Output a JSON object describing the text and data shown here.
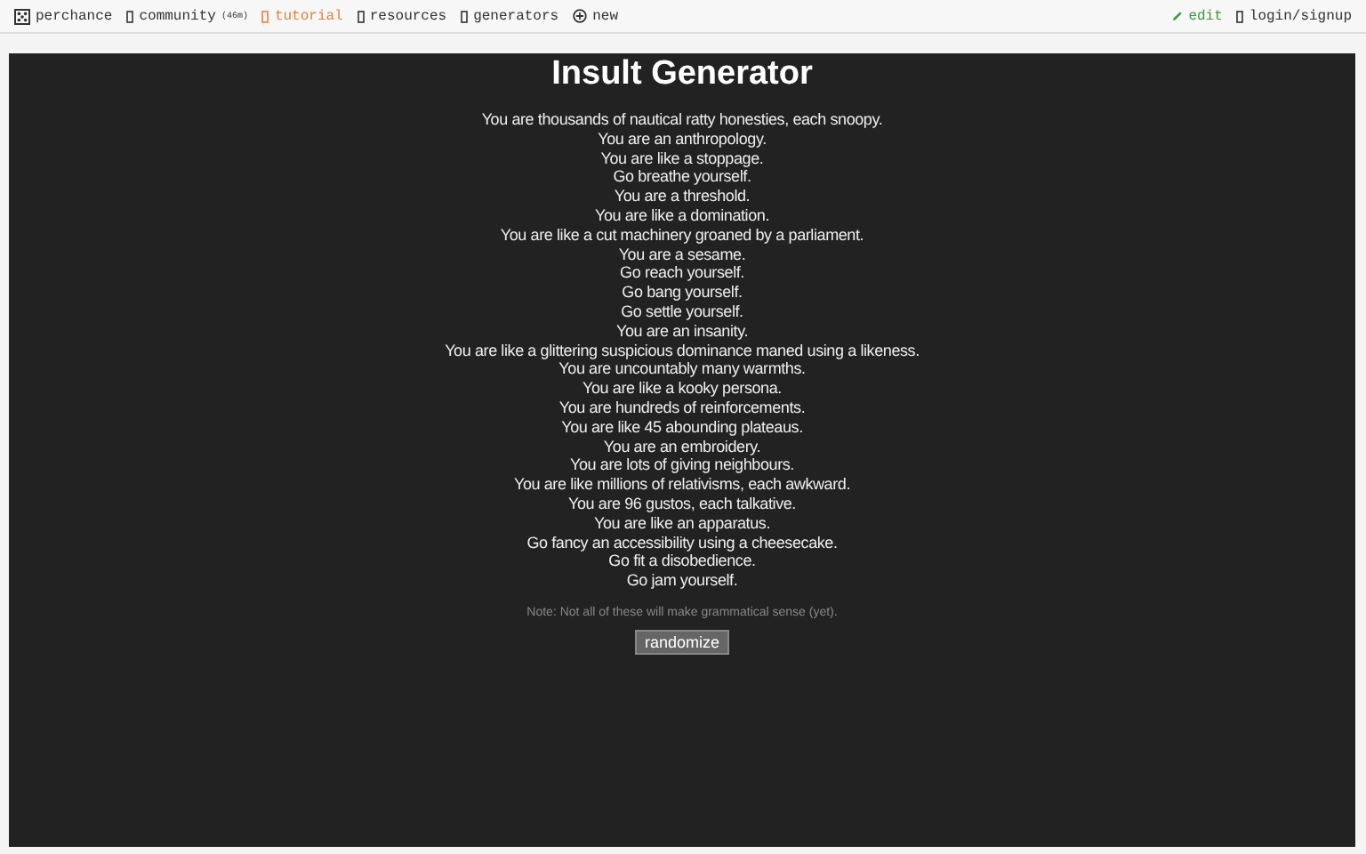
{
  "nav": {
    "brand": "perchance",
    "left_links": [
      {
        "label": "community",
        "note": "(46m)",
        "active": false
      },
      {
        "label": "tutorial",
        "active": true
      },
      {
        "label": "resources",
        "active": false
      },
      {
        "label": "generators",
        "active": false
      },
      {
        "label": "new",
        "active": false
      }
    ],
    "right_links": [
      {
        "label": "edit",
        "kind": "edit"
      },
      {
        "label": "login/signup",
        "kind": "plain"
      }
    ]
  },
  "title": "Insult Generator",
  "lines": [
    "You are thousands of nautical ratty honesties, each snoopy.",
    "You are an anthropology.",
    "You are like a stoppage.",
    "Go breathe yourself.",
    "You are a threshold.",
    "You are like a domination.",
    "You are like a cut machinery groaned by a parliament.",
    "You are a sesame.",
    "Go reach yourself.",
    "Go bang yourself.",
    "Go settle yourself.",
    "You are an insanity.",
    "You are like a glittering suspicious dominance maned using a likeness.",
    "You are uncountably many warmths.",
    "You are like a kooky persona.",
    "You are hundreds of reinforcements.",
    "You are like 45 abounding plateaus.",
    "You are an embroidery.",
    "You are lots of giving neighbours.",
    "You are like millions of relativisms, each awkward.",
    "You are 96 gustos, each talkative.",
    "You are like an apparatus.",
    "Go fancy an accessibility using a cheesecake.",
    "Go fit a disobedience.",
    "Go jam yourself."
  ],
  "note": "Note: Not all of these will make grammatical sense (yet).",
  "button": "randomize"
}
